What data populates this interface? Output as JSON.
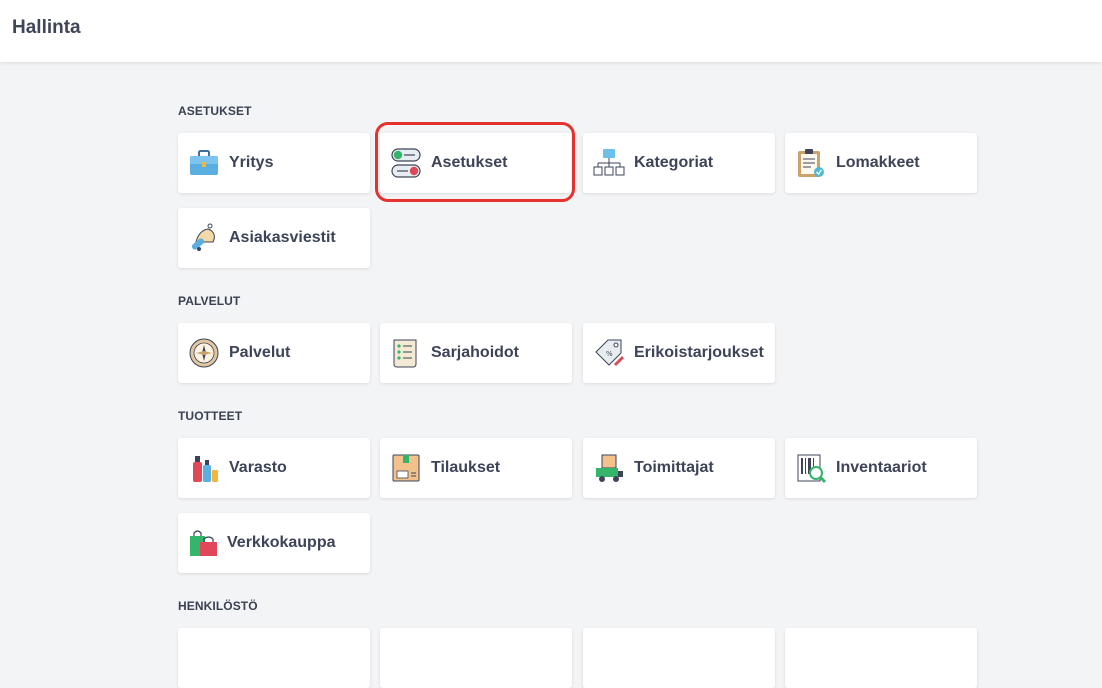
{
  "header": {
    "title": "Hallinta"
  },
  "sections": {
    "asetukset": {
      "title": "ASETUKSET",
      "items": [
        {
          "label": "Yritys",
          "icon": "briefcase-icon"
        },
        {
          "label": "Asetukset",
          "icon": "toggle-switches-icon"
        },
        {
          "label": "Kategoriat",
          "icon": "hierarchy-icon"
        },
        {
          "label": "Lomakkeet",
          "icon": "clipboard-icon"
        },
        {
          "label": "Asiakasviestit",
          "icon": "bell-icon"
        }
      ]
    },
    "palvelut": {
      "title": "PALVELUT",
      "items": [
        {
          "label": "Palvelut",
          "icon": "compass-icon"
        },
        {
          "label": "Sarjahoidot",
          "icon": "list-scroll-icon"
        },
        {
          "label": "Erikoistarjoukset",
          "icon": "price-tag-icon"
        }
      ]
    },
    "tuotteet": {
      "title": "TUOTTEET",
      "items": [
        {
          "label": "Varasto",
          "icon": "bottles-icon"
        },
        {
          "label": "Tilaukset",
          "icon": "box-icon"
        },
        {
          "label": "Toimittajat",
          "icon": "delivery-truck-icon"
        },
        {
          "label": "Inventaariot",
          "icon": "barcode-icon"
        },
        {
          "label": "Verkkokauppa",
          "icon": "shopping-bags-icon"
        }
      ]
    },
    "henkilosto": {
      "title": "HENKILÖSTÖ"
    }
  },
  "colors": {
    "highlight": "#e5322c",
    "background": "#f3f4f6",
    "card": "#ffffff",
    "text": "#3d4458"
  }
}
